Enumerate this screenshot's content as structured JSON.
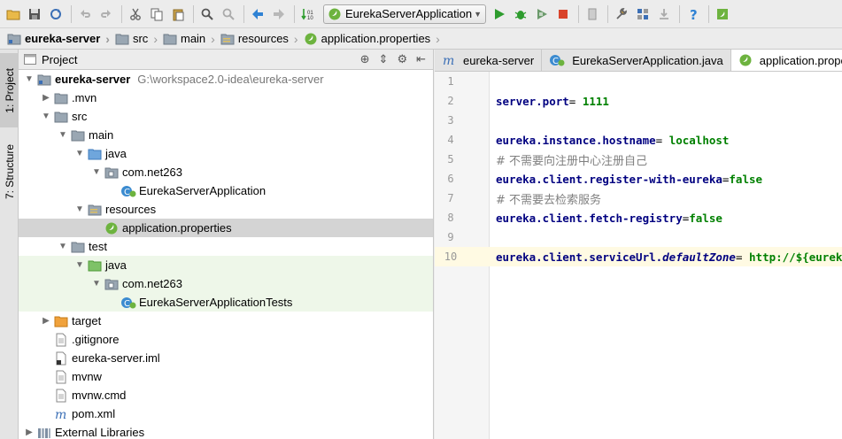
{
  "toolbar": {
    "run_config": "EurekaServerApplication",
    "colors": {
      "run": "#2e9c2e",
      "stop": "#d9442b",
      "nav": "#2f82d4"
    }
  },
  "breadcrumb": [
    "eureka-server",
    "src",
    "main",
    "resources",
    "application.properties"
  ],
  "left_strip": {
    "project_tab": "1: Project",
    "structure_tab": "7: Structure"
  },
  "project_panel": {
    "title": "Project",
    "tree": [
      {
        "label": "eureka-server",
        "path": "G:\\workspace2.0-idea\\eureka-server",
        "depth": 0,
        "toggle": "open",
        "icon": "module-folder-icon",
        "bold": true
      },
      {
        "label": ".mvn",
        "depth": 1,
        "toggle": "closed",
        "icon": "folder-icon"
      },
      {
        "label": "src",
        "depth": 1,
        "toggle": "open",
        "icon": "folder-icon"
      },
      {
        "label": "main",
        "depth": 2,
        "toggle": "open",
        "icon": "folder-icon"
      },
      {
        "label": "java",
        "depth": 3,
        "toggle": "open",
        "icon": "source-folder-icon"
      },
      {
        "label": "com.net263",
        "depth": 4,
        "toggle": "open",
        "icon": "package-icon"
      },
      {
        "label": "EurekaServerApplication",
        "depth": 5,
        "toggle": "none",
        "icon": "spring-class-icon"
      },
      {
        "label": "resources",
        "depth": 3,
        "toggle": "open",
        "icon": "resources-folder-icon"
      },
      {
        "label": "application.properties",
        "depth": 4,
        "toggle": "none",
        "icon": "spring-properties-icon",
        "selected": true
      },
      {
        "label": "test",
        "depth": 2,
        "toggle": "open",
        "icon": "folder-icon"
      },
      {
        "label": "java",
        "depth": 3,
        "toggle": "open",
        "icon": "test-folder-icon",
        "test": true
      },
      {
        "label": "com.net263",
        "depth": 4,
        "toggle": "open",
        "icon": "package-icon",
        "test": true
      },
      {
        "label": "EurekaServerApplicationTests",
        "depth": 5,
        "toggle": "none",
        "icon": "test-class-icon",
        "test": true
      },
      {
        "label": "target",
        "depth": 1,
        "toggle": "closed",
        "icon": "excluded-folder-icon"
      },
      {
        "label": ".gitignore",
        "depth": 1,
        "toggle": "none",
        "icon": "text-file-icon"
      },
      {
        "label": "eureka-server.iml",
        "depth": 1,
        "toggle": "none",
        "icon": "iml-file-icon"
      },
      {
        "label": "mvnw",
        "depth": 1,
        "toggle": "none",
        "icon": "text-file-icon"
      },
      {
        "label": "mvnw.cmd",
        "depth": 1,
        "toggle": "none",
        "icon": "text-file-icon"
      },
      {
        "label": "pom.xml",
        "depth": 1,
        "toggle": "none",
        "icon": "maven-icon"
      },
      {
        "label": "External Libraries",
        "depth": 0,
        "toggle": "closed",
        "icon": "library-icon"
      }
    ]
  },
  "editor": {
    "tabs": [
      {
        "label": "eureka-server",
        "icon": "maven-icon"
      },
      {
        "label": "EurekaServerApplication.java",
        "icon": "spring-class-icon"
      },
      {
        "label": "application.properties",
        "icon": "spring-properties-icon",
        "active": true
      }
    ],
    "current_line": 10,
    "lines": [
      {
        "n": "1",
        "parts": []
      },
      {
        "n": "2",
        "parts": [
          {
            "t": "server.port",
            "c": "k"
          },
          {
            "t": "= ",
            "c": ""
          },
          {
            "t": "1111",
            "c": "v"
          }
        ]
      },
      {
        "n": "3",
        "parts": []
      },
      {
        "n": "4",
        "parts": [
          {
            "t": "eureka.instance.hostname",
            "c": "k"
          },
          {
            "t": "= ",
            "c": ""
          },
          {
            "t": "localhost",
            "c": "v"
          }
        ]
      },
      {
        "n": "5",
        "parts": [
          {
            "t": "# 不需要向注册中心注册自己",
            "c": "c"
          }
        ]
      },
      {
        "n": "6",
        "parts": [
          {
            "t": "eureka.client.register-with-eureka",
            "c": "k"
          },
          {
            "t": "=",
            "c": ""
          },
          {
            "t": "false",
            "c": "v"
          }
        ]
      },
      {
        "n": "7",
        "parts": [
          {
            "t": "# 不需要去检索服务",
            "c": "c"
          }
        ]
      },
      {
        "n": "8",
        "parts": [
          {
            "t": "eureka.client.fetch-registry",
            "c": "k"
          },
          {
            "t": "=",
            "c": ""
          },
          {
            "t": "false",
            "c": "v"
          }
        ]
      },
      {
        "n": "9",
        "parts": []
      },
      {
        "n": "10",
        "parts": [
          {
            "t": "eureka.client.serviceUrl.",
            "c": "k"
          },
          {
            "t": "defaultZone",
            "c": "k i"
          },
          {
            "t": "= ",
            "c": ""
          },
          {
            "t": "http://${eureka.instance.hostname}:${server.port}/eureka/",
            "c": "v"
          }
        ]
      }
    ]
  }
}
